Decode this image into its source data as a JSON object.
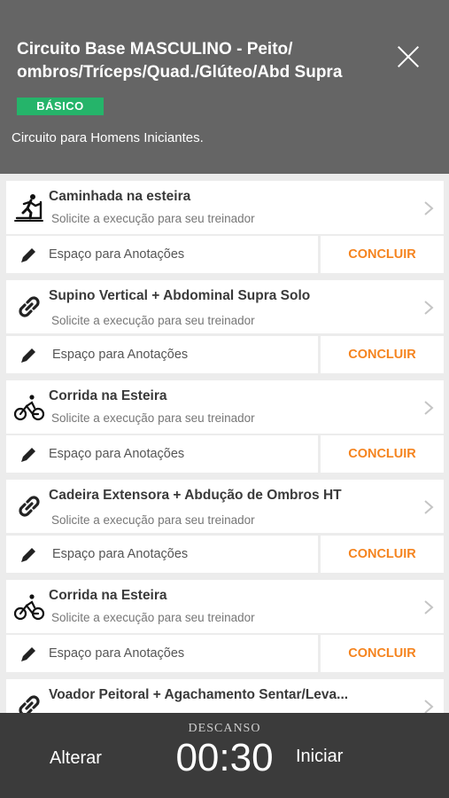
{
  "header": {
    "title": "Circuito Base MASCULINO - Peito/ ombros/Tríceps/Quad./Glúteo/Abd Supra",
    "level": "BÁSICO",
    "description": "Circuito para Homens Iniciantes."
  },
  "exercises": [
    {
      "name": "Caminhada na esteira",
      "subtitle": "Solicite a execução para seu treinador",
      "icon": "treadmill-runner-icon",
      "notes_label": "Espaço para Anotações",
      "conclude_label": "CONCLUIR"
    },
    {
      "name": "Supino Vertical + Abdominal Supra Solo",
      "subtitle": "Solicite a execução para seu treinador",
      "icon": "link-icon",
      "notes_label": "Espaço para Anotações",
      "conclude_label": "CONCLUIR"
    },
    {
      "name": "Corrida na Esteira",
      "subtitle": "Solicite a execução para seu treinador",
      "icon": "cyclist-icon",
      "notes_label": "Espaço para Anotações",
      "conclude_label": "CONCLUIR"
    },
    {
      "name": "Cadeira Extensora + Abdução de Ombros HT",
      "subtitle": "Solicite a execução para seu treinador",
      "icon": "link-icon",
      "notes_label": "Espaço para Anotações",
      "conclude_label": "CONCLUIR"
    },
    {
      "name": "Corrida na Esteira",
      "subtitle": "Solicite a execução para seu treinador",
      "icon": "cyclist-icon",
      "notes_label": "Espaço para Anotações",
      "conclude_label": "CONCLUIR"
    },
    {
      "name": "Voador Peitoral + Agachamento Sentar/Leva...",
      "subtitle": "",
      "icon": "link-icon"
    }
  ],
  "footer": {
    "change_label": "Alterar",
    "rest_label": "DESCANSO",
    "timer": "00:30",
    "start_label": "Iniciar"
  },
  "colors": {
    "header_bg": "#656565",
    "badge_green": "#25b46a",
    "accent_orange": "#f5841f",
    "footer_bg": "#3b3b3b"
  }
}
